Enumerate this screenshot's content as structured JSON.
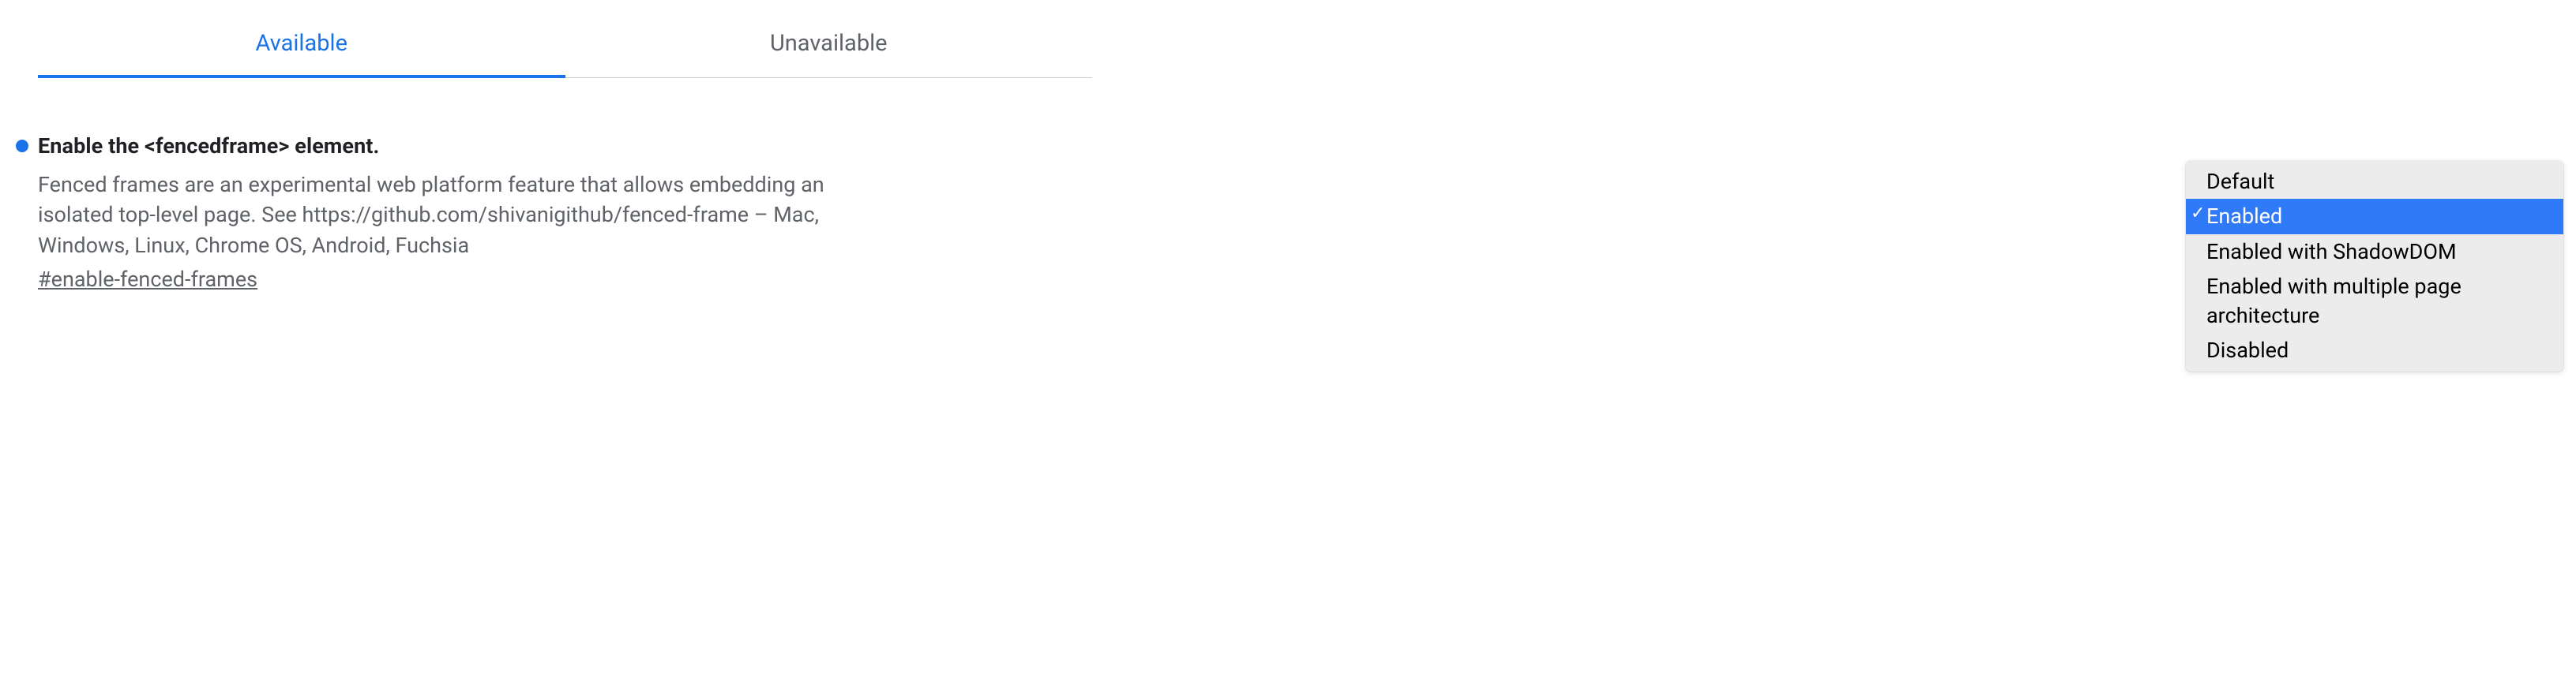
{
  "tabs": {
    "available": "Available",
    "unavailable": "Unavailable"
  },
  "flag": {
    "title": "Enable the <fencedframe> element.",
    "description": "Fenced frames are an experimental web platform feature that allows embedding an isolated top-level page. See https://github.com/shivanigithub/fenced-frame – Mac, Windows, Linux, Chrome OS, Android, Fuchsia",
    "hash": "#enable-fenced-frames"
  },
  "dropdown": {
    "options": [
      "Default",
      "Enabled",
      "Enabled with ShadowDOM",
      "Enabled with multiple page architecture",
      "Disabled"
    ],
    "selected_index": 1
  }
}
